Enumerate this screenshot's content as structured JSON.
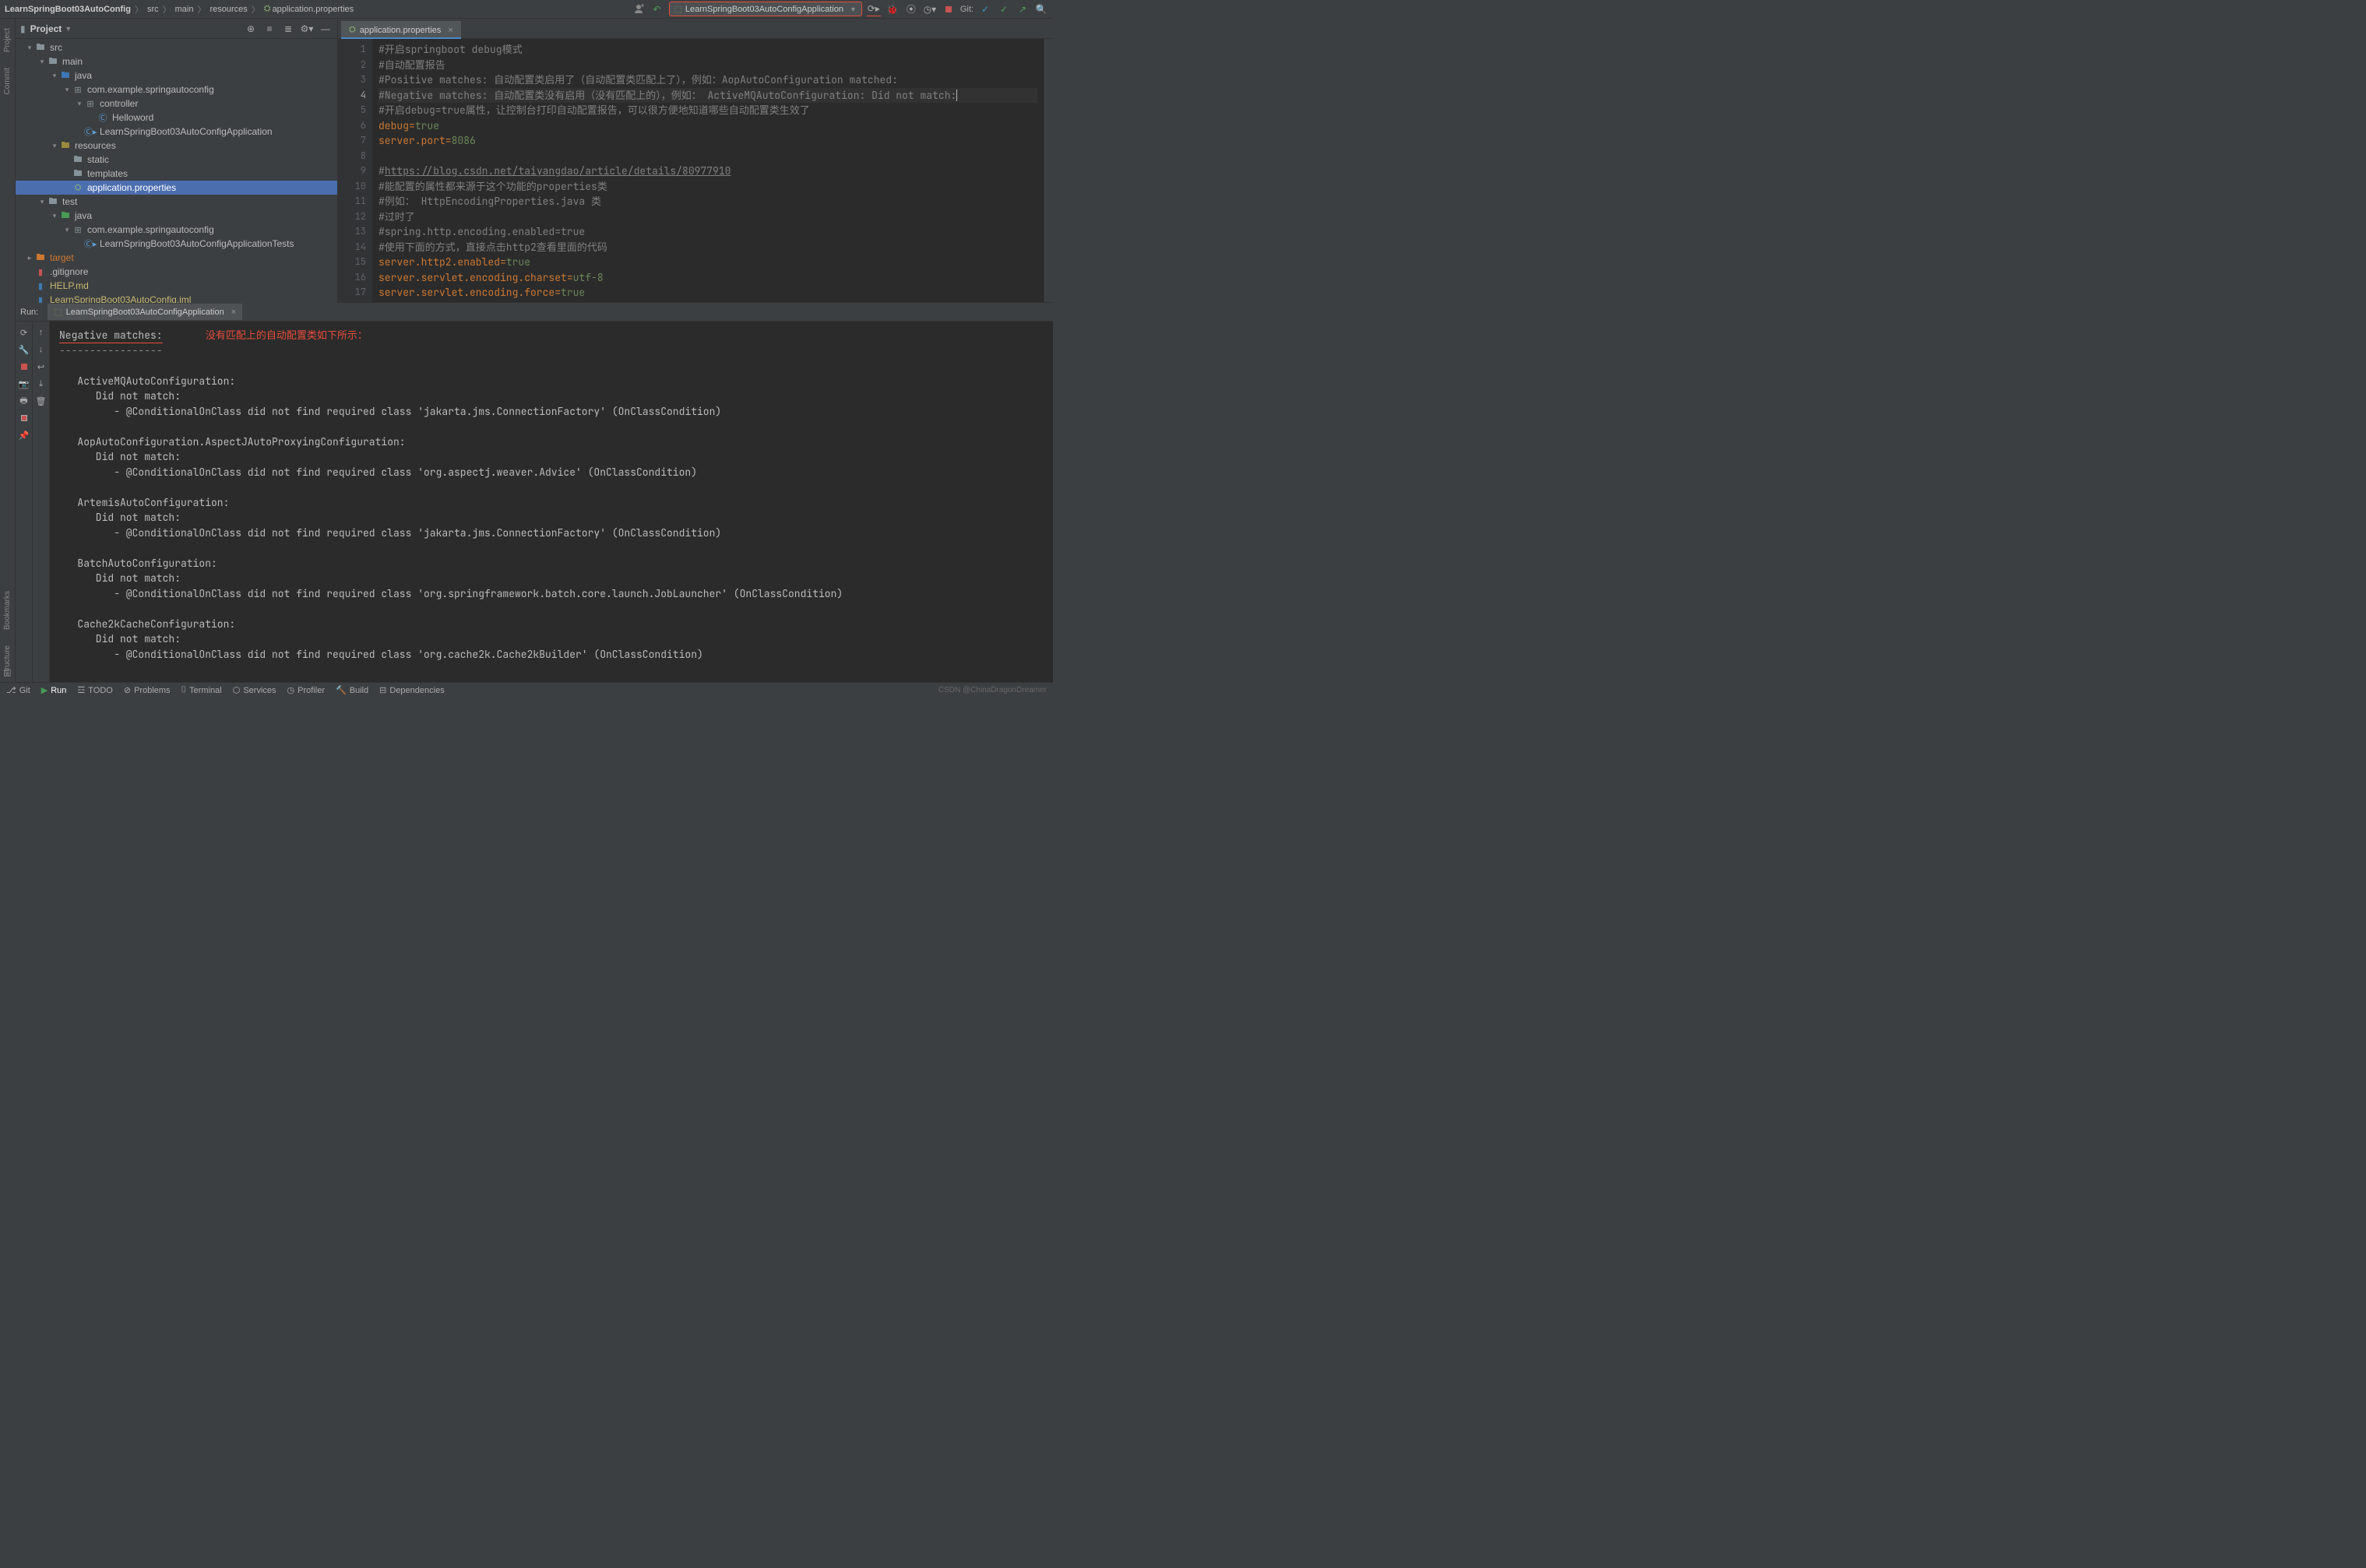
{
  "breadcrumbs": {
    "project": "LearnSpringBoot03AutoConfig",
    "parts": [
      "src",
      "main",
      "resources",
      "application.properties"
    ]
  },
  "runConfig": "LearnSpringBoot03AutoConfigApplication",
  "gitLabel": "Git:",
  "projectPanel": {
    "title": "Project"
  },
  "tree": [
    {
      "depth": 0,
      "arrow": "▾",
      "icon": "folder",
      "label": "src"
    },
    {
      "depth": 1,
      "arrow": "▾",
      "icon": "folder",
      "label": "main"
    },
    {
      "depth": 2,
      "arrow": "▾",
      "icon": "folder-src",
      "label": "java"
    },
    {
      "depth": 3,
      "arrow": "▾",
      "icon": "package",
      "label": "com.example.springautoconfig"
    },
    {
      "depth": 4,
      "arrow": "▾",
      "icon": "package",
      "label": "controller"
    },
    {
      "depth": 5,
      "arrow": "",
      "icon": "class",
      "label": "Helloword"
    },
    {
      "depth": 4,
      "arrow": "",
      "icon": "class-run",
      "label": "LearnSpringBoot03AutoConfigApplication"
    },
    {
      "depth": 2,
      "arrow": "▾",
      "icon": "folder-res",
      "label": "resources"
    },
    {
      "depth": 3,
      "arrow": "",
      "icon": "folder",
      "label": "static"
    },
    {
      "depth": 3,
      "arrow": "",
      "icon": "folder",
      "label": "templates"
    },
    {
      "depth": 3,
      "arrow": "",
      "icon": "props",
      "label": "application.properties",
      "selected": true
    },
    {
      "depth": 1,
      "arrow": "▾",
      "icon": "folder",
      "label": "test"
    },
    {
      "depth": 2,
      "arrow": "▾",
      "icon": "folder-test",
      "label": "java"
    },
    {
      "depth": 3,
      "arrow": "▾",
      "icon": "package",
      "label": "com.example.springautoconfig"
    },
    {
      "depth": 4,
      "arrow": "",
      "icon": "class-run",
      "label": "LearnSpringBoot03AutoConfigApplicationTests"
    },
    {
      "depth": 0,
      "arrow": "▸",
      "icon": "folder-excl",
      "label": "target",
      "orange": true
    },
    {
      "depth": 0,
      "arrow": "",
      "icon": "gitignore",
      "label": ".gitignore"
    },
    {
      "depth": 0,
      "arrow": "",
      "icon": "md",
      "label": "HELP.md",
      "yellow": true
    },
    {
      "depth": 0,
      "arrow": "",
      "icon": "iml",
      "label": "LearnSpringBoot03AutoConfig.iml",
      "yellow": true
    }
  ],
  "editor": {
    "tab": "application.properties",
    "currentLine": 4,
    "lines": [
      {
        "n": 1,
        "t": "comment",
        "text": "#开启springboot debug模式"
      },
      {
        "n": 2,
        "t": "comment",
        "text": "#自动配置报告"
      },
      {
        "n": 3,
        "t": "comment",
        "text": "#Positive matches: 自动配置类启用了（自动配置类匹配上了），例如：AopAutoConfiguration matched:"
      },
      {
        "n": 4,
        "t": "comment",
        "text": "#Negative matches: 自动配置类没有启用（没有匹配上的），例如： ActiveMQAutoConfiguration: Did not match:",
        "caret": true
      },
      {
        "n": 5,
        "t": "comment",
        "text": "#开启debug=true属性，让控制台打印自动配置报告，可以很方便地知道哪些自动配置类生效了"
      },
      {
        "n": 6,
        "t": "kv",
        "key": "debug",
        "val": "true"
      },
      {
        "n": 7,
        "t": "kv",
        "key": "server.port",
        "val": "8086"
      },
      {
        "n": 8,
        "t": "empty",
        "text": ""
      },
      {
        "n": 9,
        "t": "link",
        "text": "#",
        "url": "https://blog.csdn.net/taiyangdao/article/details/80977910"
      },
      {
        "n": 10,
        "t": "comment",
        "text": "#能配置的属性都来源于这个功能的properties类"
      },
      {
        "n": 11,
        "t": "comment",
        "text": "#例如： HttpEncodingProperties.java 类"
      },
      {
        "n": 12,
        "t": "comment",
        "text": "#过时了"
      },
      {
        "n": 13,
        "t": "comment",
        "text": "#spring.http.encoding.enabled=true"
      },
      {
        "n": 14,
        "t": "comment",
        "text": "#使用下面的方式，直接点击http2查看里面的代码"
      },
      {
        "n": 15,
        "t": "kv",
        "key": "server.http2.enabled",
        "val": "true"
      },
      {
        "n": 16,
        "t": "kv",
        "key": "server.servlet.encoding.charset",
        "val": "utf-8"
      },
      {
        "n": 17,
        "t": "kv",
        "key": "server.servlet.encoding.force",
        "val": "true"
      }
    ]
  },
  "runTool": {
    "label": "Run:",
    "tab": "LearnSpringBoot03AutoConfigApplication",
    "heading": "Negative matches:",
    "headingDash": "-----------------",
    "annotation": "没有匹配上的自动配置类如下所示：",
    "blocks": [
      {
        "title": "ActiveMQAutoConfiguration:",
        "sub": "Did not match:",
        "detail": "- @ConditionalOnClass did not find required class 'jakarta.jms.ConnectionFactory' (OnClassCondition)"
      },
      {
        "title": "AopAutoConfiguration.AspectJAutoProxyingConfiguration:",
        "sub": "Did not match:",
        "detail": "- @ConditionalOnClass did not find required class 'org.aspectj.weaver.Advice' (OnClassCondition)"
      },
      {
        "title": "ArtemisAutoConfiguration:",
        "sub": "Did not match:",
        "detail": "- @ConditionalOnClass did not find required class 'jakarta.jms.ConnectionFactory' (OnClassCondition)"
      },
      {
        "title": "BatchAutoConfiguration:",
        "sub": "Did not match:",
        "detail": "- @ConditionalOnClass did not find required class 'org.springframework.batch.core.launch.JobLauncher' (OnClassCondition)"
      },
      {
        "title": "Cache2kCacheConfiguration:",
        "sub": "Did not match:",
        "detail": "- @ConditionalOnClass did not find required class 'org.cache2k.Cache2kBuilder' (OnClassCondition)"
      }
    ]
  },
  "bottomBar": {
    "tabs": [
      "Git",
      "Run",
      "TODO",
      "Problems",
      "Terminal",
      "Services",
      "Profiler",
      "Build",
      "Dependencies"
    ]
  },
  "leftStripe": {
    "tabs": [
      "Project",
      "Commit",
      "Bookmarks",
      "Structure"
    ]
  },
  "watermark": "CSDN @ChinaDragonDreamer"
}
